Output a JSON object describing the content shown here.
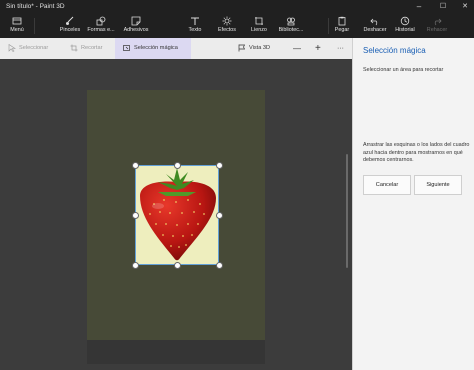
{
  "window": {
    "title": "Sin título* - Paint 3D",
    "minimize": "–",
    "maximize": "☐",
    "close": "✕"
  },
  "ribbon": {
    "menu": "Menú",
    "brushes": "Pinceles",
    "shapes": "Formas e...",
    "stickers": "Adhesivos",
    "text": "Texto",
    "effects": "Efectos",
    "canvas": "Lienzo",
    "library": "Bibliotec...",
    "paste": "Pegar",
    "undo": "Deshacer",
    "history": "Historial",
    "redo": "Rehacer"
  },
  "toolbar": {
    "select": "Seleccionar",
    "crop": "Recortar",
    "magic_select": "Selección mágica",
    "view3d": "Vista 3D",
    "zoom_out": "—",
    "zoom_in": "+",
    "more": "···"
  },
  "panel": {
    "title": "Selección mágica",
    "subtitle": "Seleccionar un área para recortar",
    "instructions": "Arrastrar las esquinas o los lados del cuadro azul hacia dentro para mostrarnos en qué debemos centrarnos.",
    "cancel": "Cancelar",
    "next": "Siguiente"
  },
  "colors": {
    "accent": "#1a5fb4",
    "selection_border": "#62a0d8",
    "artboard": "#474a37",
    "image_background": "#eeeebe",
    "strawberry": "#c01a14"
  }
}
